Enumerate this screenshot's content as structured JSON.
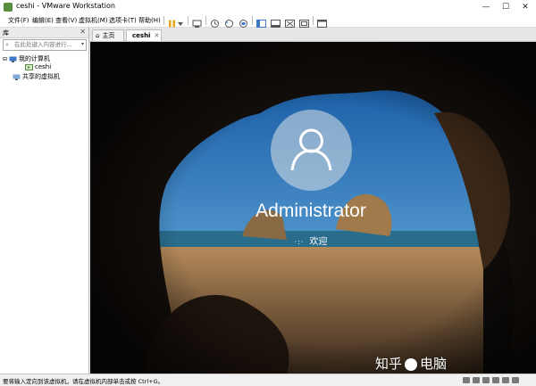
{
  "window": {
    "title": "ceshi - VMware Workstation"
  },
  "menu": [
    "文件(F)",
    "编辑(E)",
    "查看(V)",
    "虚拟机(M)",
    "选项卡(T)",
    "帮助(H)"
  ],
  "library": {
    "title": "库",
    "search_placeholder": "在此处键入内容进行...",
    "tree": {
      "my_computer": "我的计算机",
      "vm": "ceshi",
      "shared": "共享的虚拟机"
    }
  },
  "tabs": {
    "home": "主页",
    "vm": "ceshi"
  },
  "vm_screen": {
    "user": "Administrator",
    "status": "欢迎",
    "spinner": "·:·"
  },
  "statusbar": {
    "text": "要将输入定向到该虚拟机，请在虚拟机内部单击或按 Ctrl+G。"
  },
  "watermark": {
    "left": "知乎",
    "right": "电脑"
  },
  "colors": {
    "pause_button": "#e8a317",
    "accent": "#3c78c8"
  }
}
